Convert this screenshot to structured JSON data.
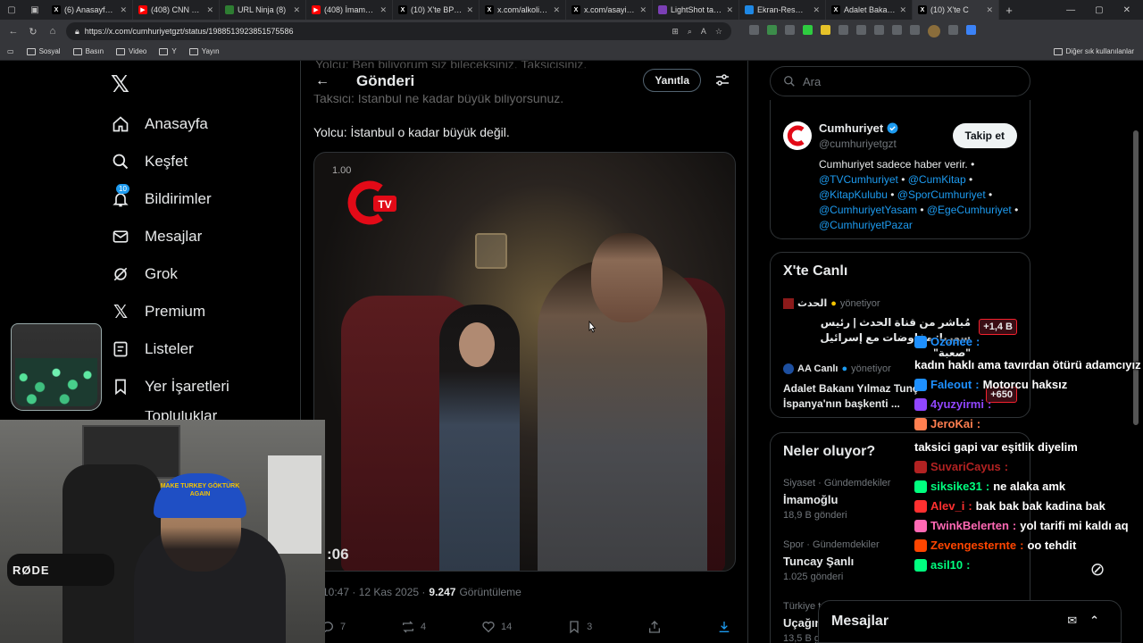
{
  "browser": {
    "tabs": [
      {
        "title": "(6) Anasayfa / X",
        "icon": "x-icon",
        "color": "#000000"
      },
      {
        "title": "(408) CNN TÜRK",
        "icon": "youtube-icon",
        "color": "#ff0000"
      },
      {
        "title": "URL Ninja (8)",
        "icon": "url-ninja-icon",
        "color": "#2e7d32"
      },
      {
        "title": "(408) İmamoğlu",
        "icon": "youtube-icon",
        "color": "#ff0000"
      },
      {
        "title": "(10) X'te BPT: \"R",
        "icon": "x-icon",
        "color": "#000000"
      },
      {
        "title": "x.com/alkolikyo",
        "icon": "x-icon",
        "color": "#000000"
      },
      {
        "title": "x.com/asayisbe",
        "icon": "x-icon",
        "color": "#000000"
      },
      {
        "title": "LightShot taraf",
        "icon": "lightshot-icon",
        "color": "#7b3fb5"
      },
      {
        "title": "Ekran-Resmi-20",
        "icon": "image-icon",
        "color": "#1e88e5"
      },
      {
        "title": "Adalet Bakanı Y",
        "icon": "x-icon",
        "color": "#000000"
      },
      {
        "title": "(10) X'te C",
        "icon": "x-icon",
        "color": "#000000"
      }
    ],
    "url": "https://x.com/cumhuriyetgzt/status/1988513923851575586",
    "bookmarks": [
      "Sosyal",
      "Basın",
      "Video",
      "Y",
      "Yayın"
    ],
    "other_bookmarks": "Diğer sık kullanılanlar"
  },
  "nav": {
    "items": [
      {
        "label": "Anasayfa",
        "icon": "home-icon"
      },
      {
        "label": "Keşfet",
        "icon": "search-icon"
      },
      {
        "label": "Bildirimler",
        "icon": "bell-icon",
        "badge": "10"
      },
      {
        "label": "Mesajlar",
        "icon": "mail-icon"
      },
      {
        "label": "Grok",
        "icon": "grok-icon"
      },
      {
        "label": "Premium",
        "icon": "x-icon"
      },
      {
        "label": "Listeler",
        "icon": "list-icon"
      },
      {
        "label": "Yer İşaretleri",
        "icon": "bookmark-icon"
      },
      {
        "label": "Topluluklar",
        "icon": "communities-icon"
      }
    ]
  },
  "post": {
    "header_title": "Gönderi",
    "reply_button": "Yanıtla",
    "faded_line_1": "Yolcu: Ben biliyorum siz bileceksiniz. Taksicisiniz.",
    "faded_line_2": "Taksici: İstanbul ne kadar büyük biliyorsunuz.",
    "text": "Yolcu: İstanbul o kadar büyük değil.",
    "video_time": "1.00",
    "video_logo": "TV",
    "video_duration": ":06",
    "time": "10:47 · 12 Kas 2025 ·",
    "views": "9.247",
    "views_label": "Görüntüleme",
    "replies": "7",
    "reposts": "4",
    "likes": "14",
    "bookmarks": "3"
  },
  "sidebar": {
    "search_placeholder": "Ara",
    "account": {
      "name": "Cumhuriyet",
      "handle": "@cumhuriyetgzt",
      "follow": "Takip et",
      "bio_text": "Cumhuriyet sadece haber verir. •",
      "bio_links": [
        "@TVCumhuriyet",
        "@CumKitap",
        "@KitapKulubu",
        "@SporCumhuriyet",
        "@CumhuriyetYasam",
        "@EgeCumhuriyet",
        "@CumhuriyetPazar"
      ]
    },
    "live": {
      "title": "X'te Canlı",
      "items": [
        {
          "host": "الحدث",
          "role": "yönetiyor",
          "title": "مُباشر من قناة الحدث | رئيس سوريا: مفاوضات مع إسرائيل \"صعبة\"",
          "count": "+1,4 B"
        },
        {
          "host": "AA Canlı",
          "role": "yönetiyor",
          "title": "Adalet Bakanı Yılmaz Tunç İspanya'nın başkenti ...",
          "count": "+650"
        }
      ]
    },
    "trends": {
      "title": "Neler oluyor?",
      "items": [
        {
          "category": "Siyaset · Gündemdekiler",
          "name": "İmamoğlu",
          "count": "18,9 B gönderi"
        },
        {
          "category": "Spor · Gündemdekiler",
          "name": "Tuncay Şanlı",
          "count": "1.025 gönderi"
        },
        {
          "category": "Türkiye t",
          "name": "Uçağın",
          "count": "13,5 B gö"
        }
      ]
    },
    "messages_title": "Mesajlar"
  },
  "chat": [
    {
      "user": "Ozonee",
      "color": "#1e90ff",
      "message": "kadın haklı ama tavırdan ötürü adamcıyız"
    },
    {
      "user": "Faleout",
      "color": "#1e90ff",
      "message": "Motorcu haksız"
    },
    {
      "user": "4yuzyirmi",
      "color": "#9146ff",
      "message": ""
    },
    {
      "user": "JeroKai",
      "color": "#ff7f50",
      "message": "taksici gapi var eşitlik diyelim"
    },
    {
      "user": "SuvariCayus",
      "color": "#b22222",
      "message": ""
    },
    {
      "user": "siksike31",
      "color": "#00ff7f",
      "message": "ne alaka amk"
    },
    {
      "user": "Alev_i",
      "color": "#ff3030",
      "message": "bak bak bak kadina bak"
    },
    {
      "user": "TwinkBelerten",
      "color": "#ff69b4",
      "message": "yol tarifi mi kaldı aq"
    },
    {
      "user": "Zevengesternte",
      "color": "#ff4500",
      "message": "oo tehdit"
    },
    {
      "user": "asil10",
      "color": "#00ff7f",
      "message": ""
    }
  ],
  "webcam": {
    "cap_text": "MAKE TURKEY GÖKTÜRK AGAIN",
    "mic_brand": "RØDE"
  }
}
